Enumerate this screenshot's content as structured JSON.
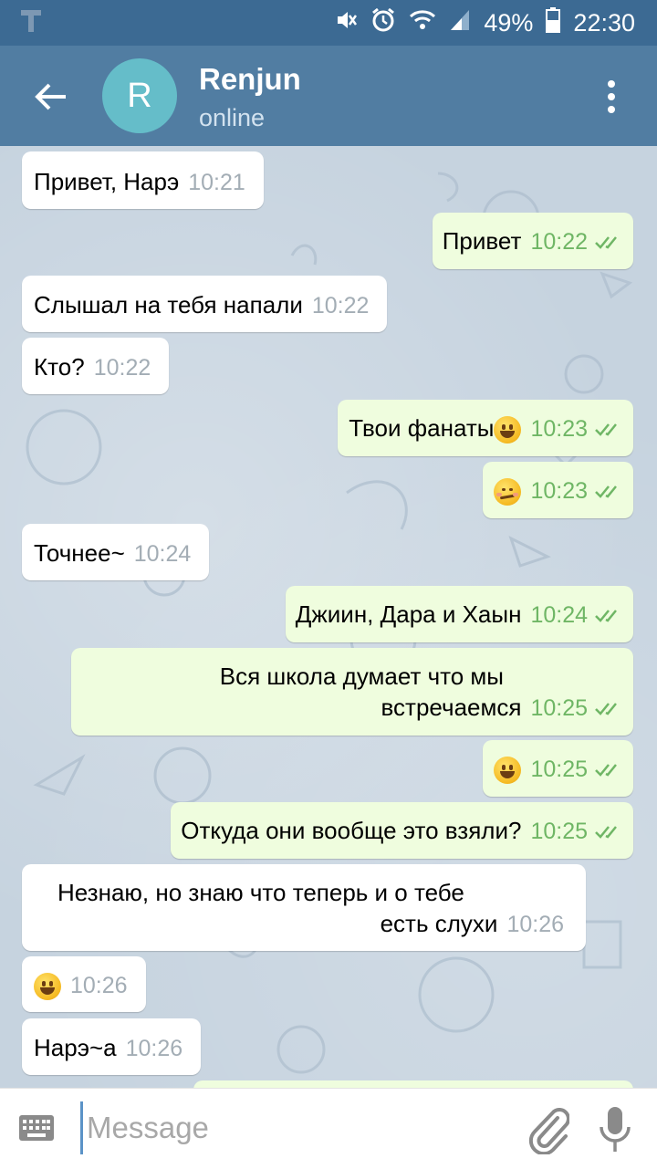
{
  "status_bar": {
    "app_icon": "T-icon",
    "battery": "49%",
    "time": "22:30"
  },
  "header": {
    "avatar_letter": "R",
    "title": "Renjun",
    "status": "online"
  },
  "messages": [
    {
      "dir": "in",
      "text": "Привет, Нарэ",
      "time": "10:21"
    },
    {
      "dir": "out",
      "text": "Привет",
      "time": "10:22"
    },
    {
      "dir": "in",
      "text": "Слышал на тебя напали",
      "time": "10:22"
    },
    {
      "dir": "in",
      "text": "Кто?",
      "time": "10:22"
    },
    {
      "dir": "out",
      "text": "Твои фанаты",
      "emoji": "grinning-emoji",
      "time": "10:23"
    },
    {
      "dir": "out",
      "text": "",
      "emoji": "smirking-emoji",
      "time": "10:23"
    },
    {
      "dir": "in",
      "text": "Точнее~",
      "time": "10:24"
    },
    {
      "dir": "out",
      "text": "Джиин, Дара и Хаын",
      "time": "10:24"
    },
    {
      "dir": "out",
      "line1": "Вся школа думает что мы",
      "line2": "встречаемся",
      "time": "10:25"
    },
    {
      "dir": "out",
      "text": "",
      "emoji": "grinning-emoji",
      "time": "10:25"
    },
    {
      "dir": "out",
      "text": "Откуда они вообще это взяли?",
      "time": "10:25"
    },
    {
      "dir": "in",
      "line1": "Незнаю, но знаю что теперь и о тебе",
      "line2": "есть слухи",
      "time": "10:26"
    },
    {
      "dir": "in",
      "text": "",
      "emoji": "grinning-emoji",
      "time": "10:26"
    },
    {
      "dir": "in",
      "text": "Нарэ~а",
      "time": "10:26"
    }
  ],
  "input": {
    "placeholder": "Message"
  }
}
